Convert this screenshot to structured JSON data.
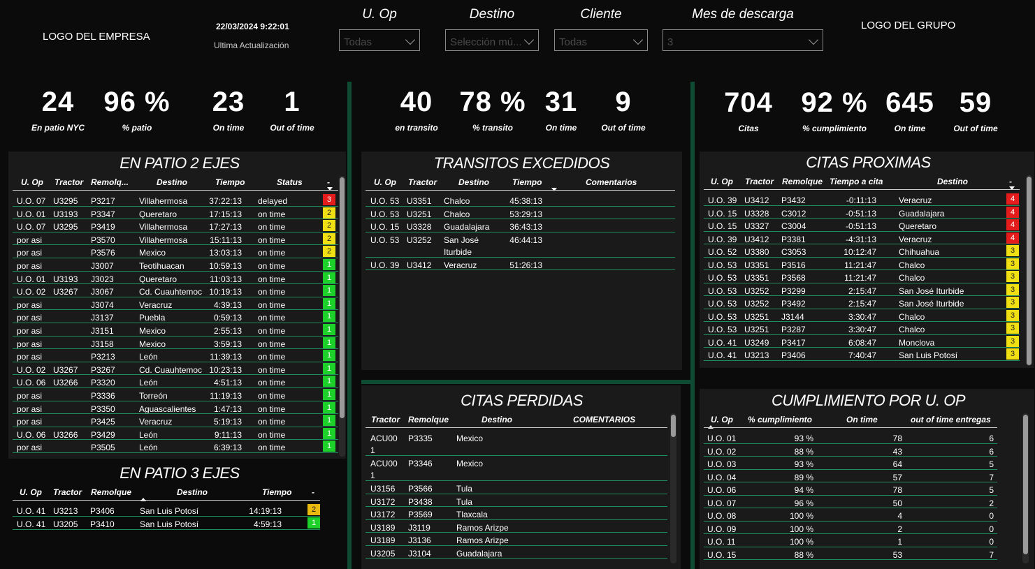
{
  "header": {
    "logo_company": "LOGO DEL EMPRESA",
    "logo_group": "LOGO DEL GRUPO",
    "timestamp": "22/03/2024 9:22:01",
    "timestamp_label": "Ultima Actualización"
  },
  "filters": [
    {
      "label": "U. Op",
      "value": "Todas"
    },
    {
      "label": "Destino",
      "value": "Selección mú..."
    },
    {
      "label": "Cliente",
      "value": "Todas"
    },
    {
      "label": "Mes de descarga",
      "value": "3"
    }
  ],
  "kpis": [
    {
      "value": "24",
      "label": "En patio NYC"
    },
    {
      "value": "96 %",
      "label": "% patio"
    },
    {
      "value": "23",
      "label": "On time"
    },
    {
      "value": "1",
      "label": "Out of time"
    },
    {
      "value": "40",
      "label": "en transito"
    },
    {
      "value": "78 %",
      "label": "% transito"
    },
    {
      "value": "31",
      "label": "On time"
    },
    {
      "value": "9",
      "label": "Out of time"
    },
    {
      "value": "704",
      "label": "Citas"
    },
    {
      "value": "92 %",
      "label": "% cumplimiento"
    },
    {
      "value": "645",
      "label": "On time"
    },
    {
      "value": "59",
      "label": "Out of time"
    }
  ],
  "patio2": {
    "title": "EN PATIO 2 EJES",
    "headers": [
      "U. Op",
      "Tractor",
      "Remolq...",
      "Destino",
      "Tiempo",
      "Status",
      "-"
    ],
    "rows": [
      [
        "U.O. 07",
        "U3295",
        "P3217",
        "Villahermosa",
        "37:22:13",
        "delayed",
        "3"
      ],
      [
        "U.O. 01",
        "U3193",
        "P3347",
        "Queretaro",
        "17:15:13",
        "on time",
        "2"
      ],
      [
        "U.O. 07",
        "U3295",
        "P3419",
        "Villahermosa",
        "17:27:13",
        "on time",
        "2"
      ],
      [
        "por asi",
        "",
        "P3570",
        "Villahermosa",
        "15:11:13",
        "on time",
        "2"
      ],
      [
        "por asi",
        "",
        "P3576",
        "Mexico",
        "13:03:13",
        "on time",
        "2"
      ],
      [
        "por asi",
        "",
        "J3007",
        "Teotihuacan",
        "10:59:13",
        "on time",
        "1"
      ],
      [
        "U.O. 01",
        "U3193",
        "J3023",
        "Queretaro",
        "11:03:13",
        "on time",
        "1"
      ],
      [
        "U.O. 02",
        "U3267",
        "J3067",
        "Cd. Cuauhtemoc",
        "10:19:13",
        "on time",
        "1"
      ],
      [
        "por asi",
        "",
        "J3074",
        "Veracruz",
        "4:39:13",
        "on time",
        "1"
      ],
      [
        "por asi",
        "",
        "J3137",
        "Puebla",
        "0:59:13",
        "on time",
        "1"
      ],
      [
        "por asi",
        "",
        "J3151",
        "Mexico",
        "2:55:13",
        "on time",
        "1"
      ],
      [
        "por asi",
        "",
        "J3158",
        "Mexico",
        "3:59:13",
        "on time",
        "1"
      ],
      [
        "por asi",
        "",
        "P3213",
        "León",
        "11:39:13",
        "on time",
        "1"
      ],
      [
        "U.O. 02",
        "U3267",
        "P3267",
        "Cd. Cuauhtemoc",
        "10:23:13",
        "on time",
        "1"
      ],
      [
        "U.O. 06",
        "U3266",
        "P3320",
        "León",
        "4:51:13",
        "on time",
        "1"
      ],
      [
        "por asi",
        "",
        "P3336",
        "Torreón",
        "11:19:13",
        "on time",
        "1"
      ],
      [
        "por asi",
        "",
        "P3350",
        "Aguascalientes",
        "1:47:13",
        "on time",
        "1"
      ],
      [
        "por asi",
        "",
        "P3425",
        "Veracruz",
        "5:19:13",
        "on time",
        "1"
      ],
      [
        "U.O. 06",
        "U3266",
        "P3429",
        "León",
        "9:11:13",
        "on time",
        "1"
      ],
      [
        "por asi",
        "",
        "P3505",
        "León",
        "6:39:13",
        "on time",
        "1"
      ]
    ]
  },
  "patio3": {
    "title": "EN PATIO 3 EJES",
    "headers": [
      "U. Op",
      "Tractor",
      "Remolque",
      "Destino",
      "Tiempo",
      "-"
    ],
    "rows": [
      [
        "U.O. 41",
        "U3213",
        "P3406",
        "San Luis Potosí",
        "14:19:13",
        "2"
      ],
      [
        "U.O. 41",
        "U3205",
        "P3410",
        "San Luis Potosí",
        "4:59:13",
        "1"
      ]
    ]
  },
  "transitos": {
    "title": "TRANSITOS EXCEDIDOS",
    "headers": [
      "U. Op",
      "Tractor",
      "Destino",
      "Tiempo",
      "Comentarios"
    ],
    "rows": [
      [
        "U.O. 53",
        "U3351",
        "Chalco",
        "45:38:13",
        ""
      ],
      [
        "U.O. 53",
        "U3251",
        "Chalco",
        "53:29:13",
        ""
      ],
      [
        "U.O. 15",
        "U3328",
        "Guadalajara",
        "36:43:13",
        ""
      ],
      [
        "U.O. 53",
        "U3252",
        "San José\nIturbide",
        "46:44:13",
        ""
      ],
      [
        "U.O. 39",
        "U3412",
        "Veracruz",
        "51:26:13",
        ""
      ]
    ]
  },
  "citas_perdidas": {
    "title": "CITAS PERDIDAS",
    "headers": [
      "Tractor",
      "Remolque",
      "Destino",
      "COMENTARIOS"
    ],
    "rows": [
      [
        "ACU00\n1",
        "P3335",
        "Mexico",
        ""
      ],
      [
        "ACU00\n1",
        "P3346",
        "Mexico",
        ""
      ],
      [
        "U3156",
        "P3566",
        "Tula",
        ""
      ],
      [
        "U3172",
        "P3438",
        "Tula",
        ""
      ],
      [
        "U3172",
        "P3569",
        "Tlaxcala",
        ""
      ],
      [
        "U3189",
        "J3119",
        "Ramos Arizpe",
        ""
      ],
      [
        "U3189",
        "J3136",
        "Ramos Arizpe",
        ""
      ],
      [
        "U3205",
        "J3104",
        "Guadalajara",
        ""
      ]
    ]
  },
  "citas_proximas": {
    "title": "CITAS PROXIMAS",
    "headers": [
      "U. Op",
      "Tractor",
      "Remolque",
      "Tiempo a cita",
      "Destino",
      "-"
    ],
    "rows": [
      [
        "U.O. 39",
        "U3412",
        "P3432",
        "-0:11:13",
        "Veracruz",
        "4"
      ],
      [
        "U.O. 15",
        "U3328",
        "C3012",
        "-0:51:13",
        "Guadalajara",
        "4"
      ],
      [
        "U.O. 15",
        "U3327",
        "C3004",
        "-0:51:13",
        "Queretaro",
        "4"
      ],
      [
        "U.O. 39",
        "U3412",
        "P3381",
        "-4:31:13",
        "Veracruz",
        "4"
      ],
      [
        "U.O. 52",
        "U3380",
        "C3053",
        "10:12:47",
        "Chihuahua",
        "3"
      ],
      [
        "U.O. 53",
        "U3351",
        "P3516",
        "11:21:47",
        "Chalco",
        "3"
      ],
      [
        "U.O. 53",
        "U3351",
        "P3568",
        "11:21:47",
        "Chalco",
        "3"
      ],
      [
        "U.O. 53",
        "U3252",
        "P3299",
        "2:15:47",
        "San José Iturbide",
        "3"
      ],
      [
        "U.O. 53",
        "U3252",
        "P3492",
        "2:15:47",
        "San José Iturbide",
        "3"
      ],
      [
        "U.O. 53",
        "U3251",
        "J3144",
        "3:30:47",
        "Chalco",
        "3"
      ],
      [
        "U.O. 53",
        "U3251",
        "P3287",
        "3:30:47",
        "Chalco",
        "3"
      ],
      [
        "U.O. 41",
        "U3249",
        "P3417",
        "6:08:47",
        "Monclova",
        "3"
      ],
      [
        "U.O. 41",
        "U3213",
        "P3406",
        "7:40:47",
        "San Luis Potosí",
        "3"
      ]
    ]
  },
  "cumplimiento": {
    "title": "CUMPLIMIENTO POR U. OP",
    "headers": [
      "U. Op",
      "% cumplimiento",
      "On time",
      "out of time entregas"
    ],
    "rows": [
      [
        "U.O. 01",
        "93 %",
        "78",
        "6"
      ],
      [
        "U.O. 02",
        "88 %",
        "43",
        "6"
      ],
      [
        "U.O. 03",
        "93 %",
        "64",
        "5"
      ],
      [
        "U.O. 04",
        "89 %",
        "57",
        "7"
      ],
      [
        "U.O. 06",
        "94 %",
        "78",
        "5"
      ],
      [
        "U.O. 07",
        "96 %",
        "50",
        "2"
      ],
      [
        "U.O. 08",
        "100 %",
        "4",
        "0"
      ],
      [
        "U.O. 09",
        "100 %",
        "2",
        "0"
      ],
      [
        "U.O. 11",
        "100 %",
        "1",
        "0"
      ],
      [
        "U.O. 15",
        "88 %",
        "53",
        "7"
      ]
    ]
  },
  "colors": {
    "accent_green": "#1f8f5f",
    "divider": "#0f4a32",
    "badge_red": "#e51c1c",
    "badge_yellow": "#f0e013",
    "badge_green": "#1ed12a",
    "badge_orange": "#e9b90e"
  }
}
